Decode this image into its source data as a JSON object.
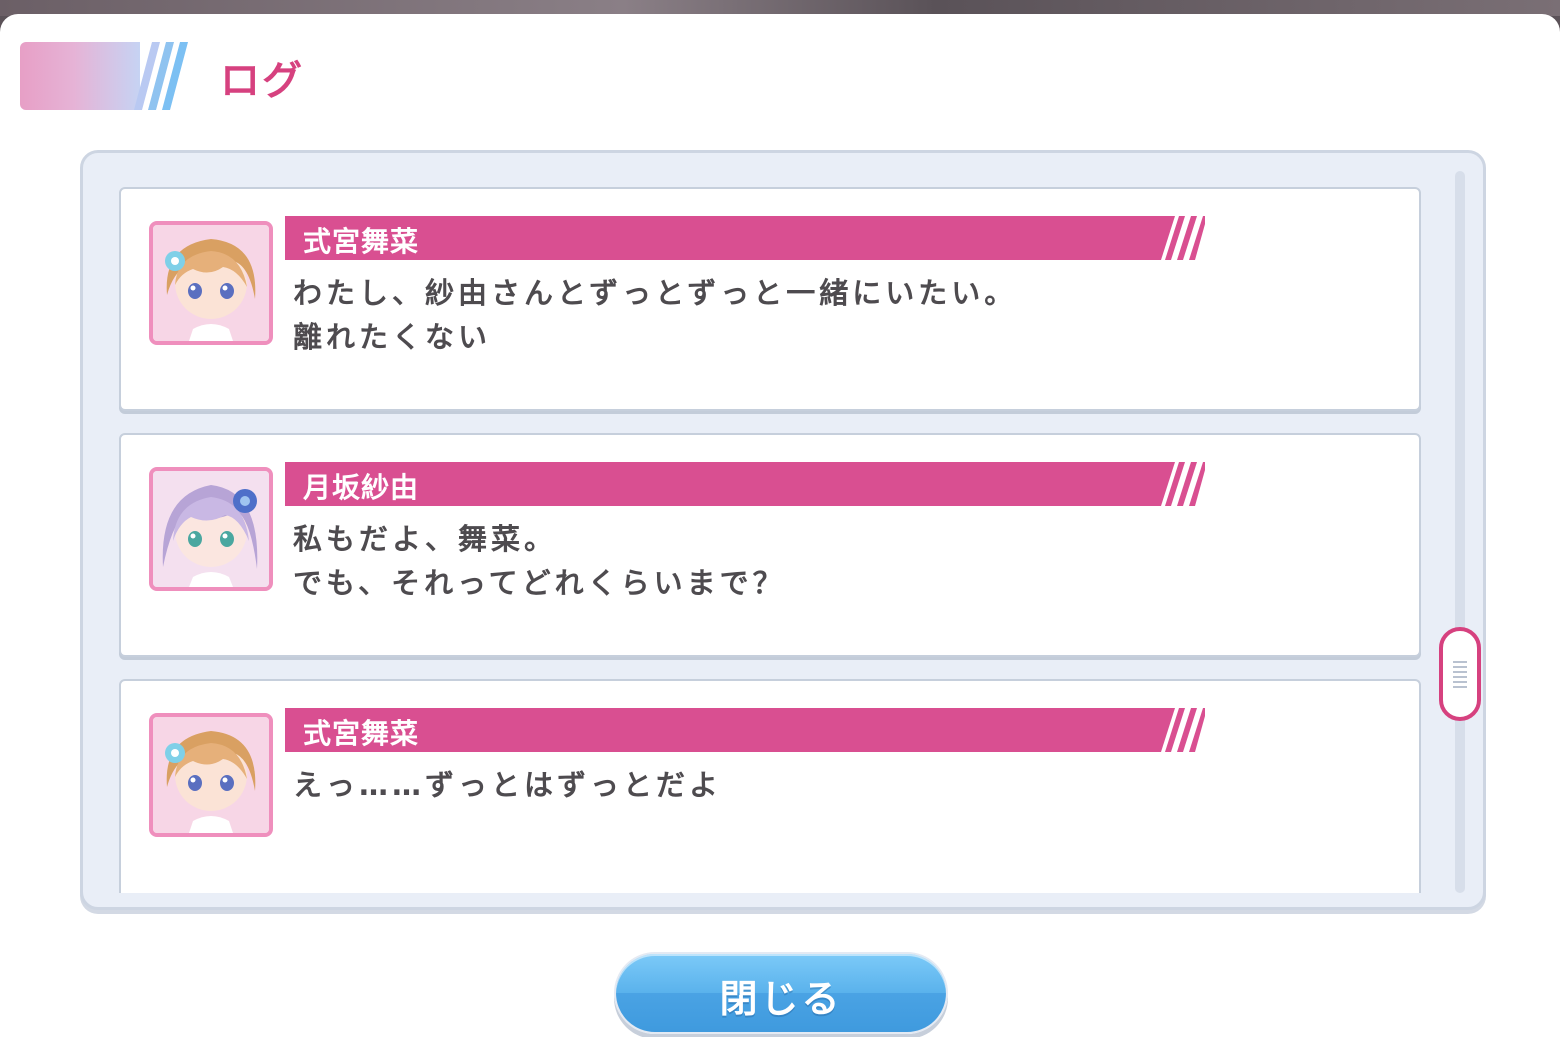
{
  "window": {
    "title": "ログ"
  },
  "colors": {
    "accent_pink": "#d6417f",
    "name_bar": "#d94f91",
    "button_blue": "#4aa3e4"
  },
  "log": {
    "entries": [
      {
        "speaker": "式宮舞菜",
        "avatar_icon": "character-avatar-maina",
        "lines": [
          "わたし、紗由さんとずっとずっと一緒にいたい。",
          "離れたくない"
        ]
      },
      {
        "speaker": "月坂紗由",
        "avatar_icon": "character-avatar-sayu",
        "lines": [
          "私もだよ、舞菜。",
          "でも、それってどれくらいまで？"
        ]
      },
      {
        "speaker": "式宮舞菜",
        "avatar_icon": "character-avatar-maina",
        "lines": [
          "えっ……ずっとはずっとだよ",
          ""
        ]
      }
    ]
  },
  "buttons": {
    "close_label": "閉じる"
  }
}
